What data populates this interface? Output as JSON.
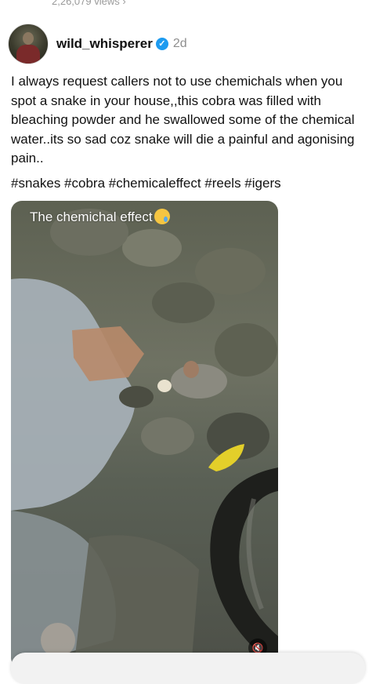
{
  "top_clip": "2,26,079 views ›",
  "post": {
    "username": "wild_whisperer",
    "time": "2d",
    "caption": "I always request callers not to use chemichals when you spot a snake in your house,,this cobra was filled with bleaching powder and he swallowed some of the chemical water..its so sad coz snake will die a painful and agonising pain..",
    "hashtags": "#snakes #cobra #chemicaleffect #reels #igers",
    "video_overlay_text": "The chemichal effect"
  },
  "icons": {
    "verified": "verified-badge-icon",
    "mute": "mute-icon",
    "emoji": "crying-face-emoji"
  },
  "colors": {
    "verified_blue": "#1d9bf0",
    "secondary_text": "#8e8e8e"
  }
}
